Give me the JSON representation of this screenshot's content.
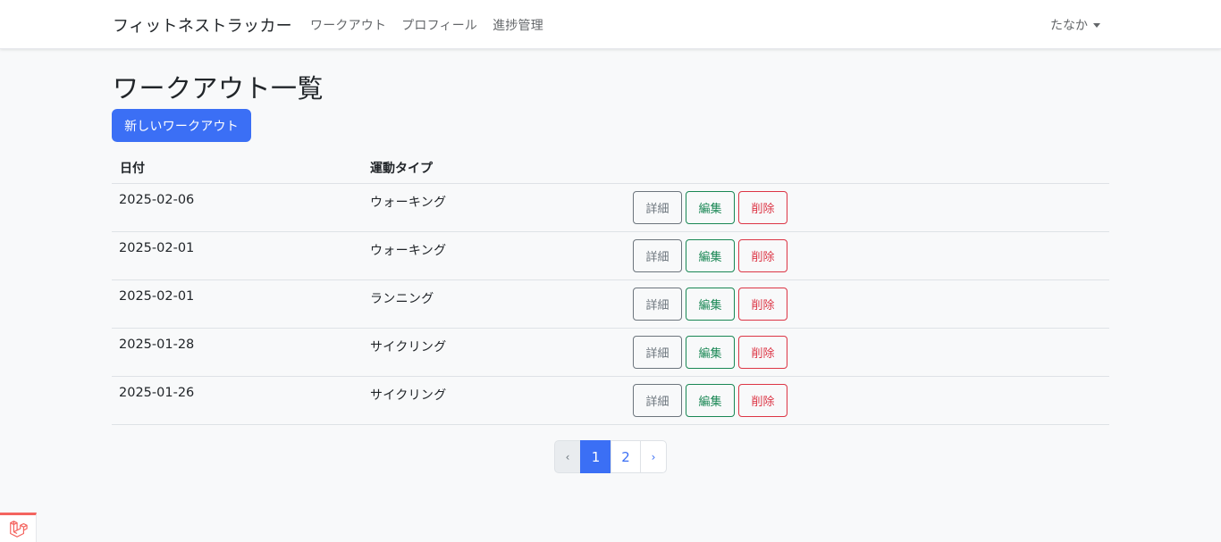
{
  "navbar": {
    "brand": "フィットネストラッカー",
    "links": [
      "ワークアウト",
      "プロフィール",
      "進捗管理"
    ],
    "user": "たなか"
  },
  "main": {
    "title": "ワークアウト一覧",
    "new_button": "新しいワークアウト",
    "table": {
      "headers": [
        "日付",
        "運動タイプ"
      ],
      "rows": [
        {
          "date": "2025-02-06",
          "type": "ウォーキング"
        },
        {
          "date": "2025-02-01",
          "type": "ウォーキング"
        },
        {
          "date": "2025-02-01",
          "type": "ランニング"
        },
        {
          "date": "2025-01-28",
          "type": "サイクリング"
        },
        {
          "date": "2025-01-26",
          "type": "サイクリング"
        }
      ],
      "actions": {
        "detail": "詳細",
        "edit": "編集",
        "delete": "削除"
      }
    },
    "pagination": {
      "prev": "‹",
      "pages": [
        "1",
        "2"
      ],
      "next": "›",
      "current": 1
    }
  },
  "colors": {
    "primary": "#3b6ff5",
    "secondary": "#6c757d",
    "success": "#198754",
    "danger": "#dc3545",
    "debug_accent": "#f4645f"
  },
  "icons": {
    "debugbar": "laravel-logo-icon"
  }
}
